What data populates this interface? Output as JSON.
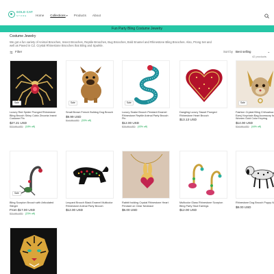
{
  "header": {
    "logo_text": "GOLD CAT",
    "logo_sub": "STORE",
    "nav": [
      {
        "label": "Home"
      },
      {
        "label": "Collections"
      },
      {
        "label": "Products"
      },
      {
        "label": "About"
      }
    ],
    "search_icon": "search-icon"
  },
  "announcement": "Fun Party Bling Costume Jewelry",
  "page": {
    "title": "Costume Jewelry",
    "description": "We got a fun variety of Animal Brooches, Insect Brooches, Reptile Brooches, Bug Brooches, Bold Enamel and Rhinestone Bling Brooches. Also, Prong Set and well as Paved in CZ. Crystal Rhinestone Brooches that Bling and Sparkle."
  },
  "toolbar": {
    "filter_label": "Filter",
    "sort_by_label": "Sort by",
    "sort_value": "Best selling",
    "count": "42 products"
  },
  "products": [
    {
      "name": "Luxury Red Spider Pronged Rhinestone Bling Brooch Shiny Cubic Zirconia Insect Costume Pin",
      "price": "$27.21 USD",
      "compare": "$32.99 USD",
      "save": "(18% off)",
      "sale_badge": "Sale",
      "color": "#141414"
    },
    {
      "name": "Small Brown French Bulldog Dog Brooch",
      "price": "$9.99 USD",
      "compare": "$14.99 USD",
      "save": "(33% off)",
      "sale_badge": "Sale",
      "color": "#ffffff"
    },
    {
      "name": "Luxury Snake Brooch Pendant Enamel Rhinestone Reptile Animal Party Brooch Pin",
      "price": "$12.00 USD",
      "compare": "$20.99 USD",
      "save": "(43% off)",
      "sale_badge": "Sale",
      "color": "#ffffff"
    },
    {
      "name": "Dangling Luxury Tassel Pronged Rhinestone Heart Brooch",
      "price": "$13.13 USD",
      "compare": "",
      "save": "",
      "sale_badge": "",
      "color": "#ffffff"
    },
    {
      "name": "Fashion Crystal Bling Chihuahua (Large Ears) Keychain Bag Accessory for Women Gold Color Keyring",
      "price": "$14.00 USD",
      "compare": "$24.99 USD",
      "save": "(44% off)",
      "sale_badge": "Sale",
      "color": "#efe6da"
    },
    {
      "name": "Bling Scorpion Brooch with Articulated Stinger",
      "price": "From $17.00 USD",
      "compare": "$21.99 USD",
      "save": "(23% off)",
      "sale_badge": "Sale",
      "color": "#ffffff"
    },
    {
      "name": "Leopard Brooch Black Enamel Multicolor Rhinestone Animal Party Brooch",
      "price": "$12.00 USD",
      "compare": "",
      "save": "",
      "sale_badge": "",
      "color": "#ffffff"
    },
    {
      "name": "Rabbit holding Crystal Rhinestone Heart Pendant on Clear Necklace",
      "price": "$6.00 USD",
      "compare": "",
      "save": "",
      "sale_badge": "",
      "color": "#d9c6b4"
    },
    {
      "name": "Multicolor Glass Rhinestone Scorpion Bling Party Stud Earrings",
      "price": "$12.00 USD",
      "compare": "",
      "save": "",
      "sale_badge": "",
      "color": "#ffffff"
    },
    {
      "name": "Rhinestone Dog Brooch Puppy Walking",
      "price": "$8.00 USD",
      "compare": "",
      "save": "",
      "sale_badge": "",
      "color": "#ffffff"
    },
    {
      "name": "",
      "price": "",
      "compare": "",
      "save": "",
      "sale_badge": "",
      "color": "#111111"
    }
  ]
}
